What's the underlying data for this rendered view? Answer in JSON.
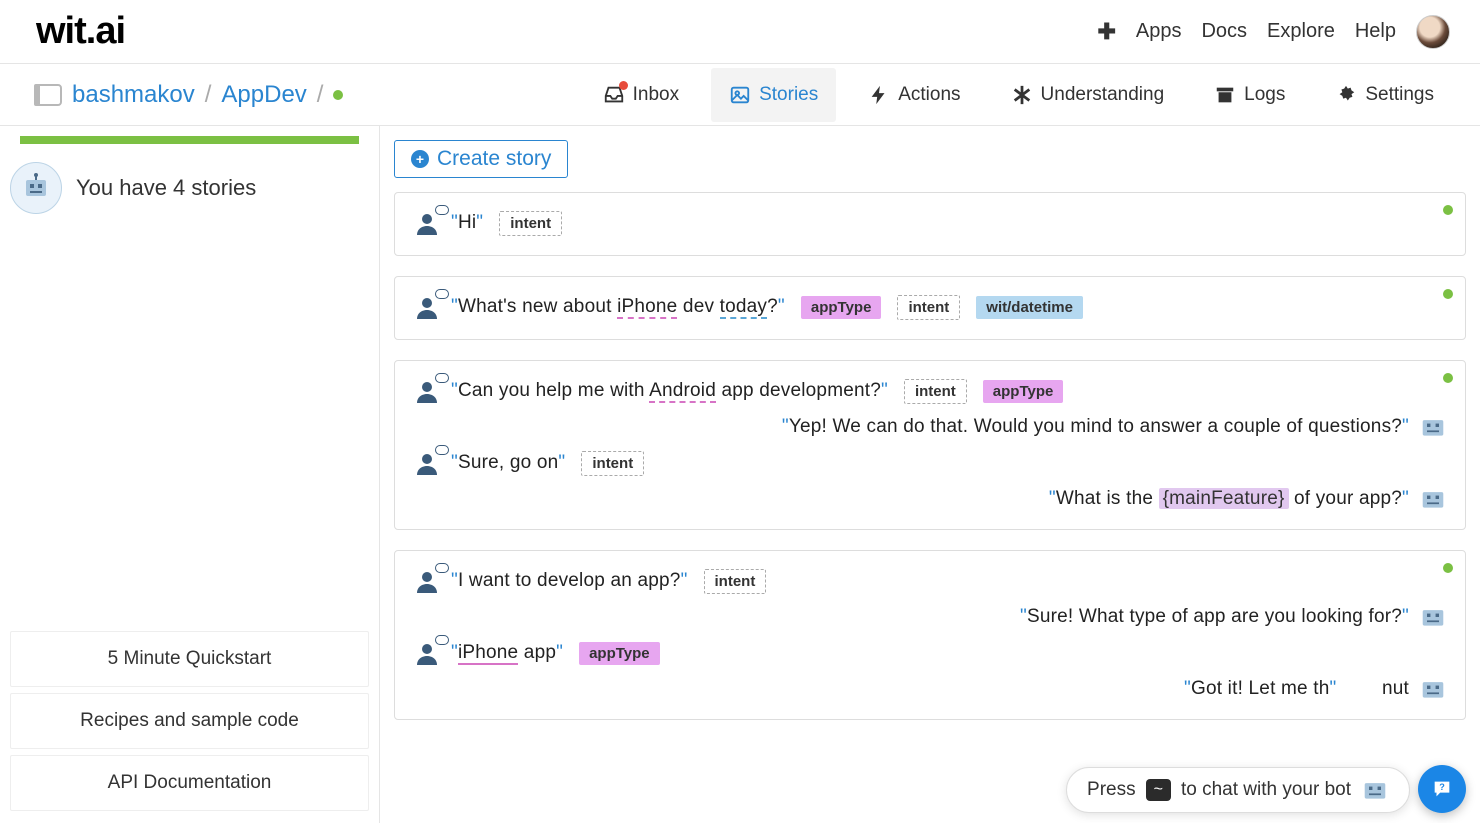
{
  "logo": "wit.ai",
  "topnav": {
    "apps": "Apps",
    "docs": "Docs",
    "explore": "Explore",
    "help": "Help"
  },
  "breadcrumbs": {
    "user": "bashmakov",
    "app": "AppDev"
  },
  "tabs": {
    "inbox": "Inbox",
    "stories": "Stories",
    "actions": "Actions",
    "understanding": "Understanding",
    "logs": "Logs",
    "settings": "Settings"
  },
  "sidebar": {
    "story_count_text": "You have 4 stories",
    "links": {
      "quickstart": "5 Minute Quickstart",
      "recipes": "Recipes and sample code",
      "api": "API Documentation"
    }
  },
  "create_story_label": "Create story",
  "entity_labels": {
    "intent": "intent",
    "appType": "appType",
    "datetime": "wit/datetime"
  },
  "stories": [
    {
      "turns": [
        {
          "who": "user",
          "pre": "",
          "ent_pink": "",
          "mid": "Hi",
          "ent_blue": "",
          "post": "",
          "tags": [
            "intent"
          ]
        }
      ]
    },
    {
      "turns": [
        {
          "who": "user",
          "pre": "What's new about ",
          "ent_pink": "iPhone",
          "mid": " dev ",
          "ent_blue": "today",
          "post": "?",
          "tags": [
            "appType",
            "intent",
            "datetime"
          ]
        }
      ]
    },
    {
      "turns": [
        {
          "who": "user",
          "pre": "Can you help me with ",
          "ent_pink": "Android",
          "mid": " app development?",
          "ent_blue": "",
          "post": "",
          "tags": [
            "intent",
            "appType"
          ]
        },
        {
          "who": "bot",
          "text": "Yep! We can do that. Would you mind to answer a couple of questions?"
        },
        {
          "who": "user",
          "pre": "Sure, go on",
          "ent_pink": "",
          "mid": "",
          "ent_blue": "",
          "post": "",
          "tags": [
            "intent"
          ]
        },
        {
          "who": "bot",
          "text_pre": "What is the ",
          "var": "{mainFeature}",
          "text_post": " of your app?"
        }
      ]
    },
    {
      "turns": [
        {
          "who": "user",
          "pre": "I want to develop an app?",
          "ent_pink": "",
          "mid": "",
          "ent_blue": "",
          "post": "",
          "tags": [
            "intent"
          ]
        },
        {
          "who": "bot",
          "text": "Sure! What type of app are you looking for?"
        },
        {
          "who": "user",
          "pre": "",
          "ent_pink": "iPhone",
          "ent_pink_style": "solid",
          "mid": " app",
          "ent_blue": "",
          "post": "",
          "tags": [
            "appType"
          ]
        },
        {
          "who": "bot",
          "text": "Got it! Let me th",
          "truncated_suffix": "nut"
        }
      ]
    }
  ],
  "chat_widget": {
    "press": "Press",
    "key": "~",
    "rest": "to chat with your bot"
  }
}
